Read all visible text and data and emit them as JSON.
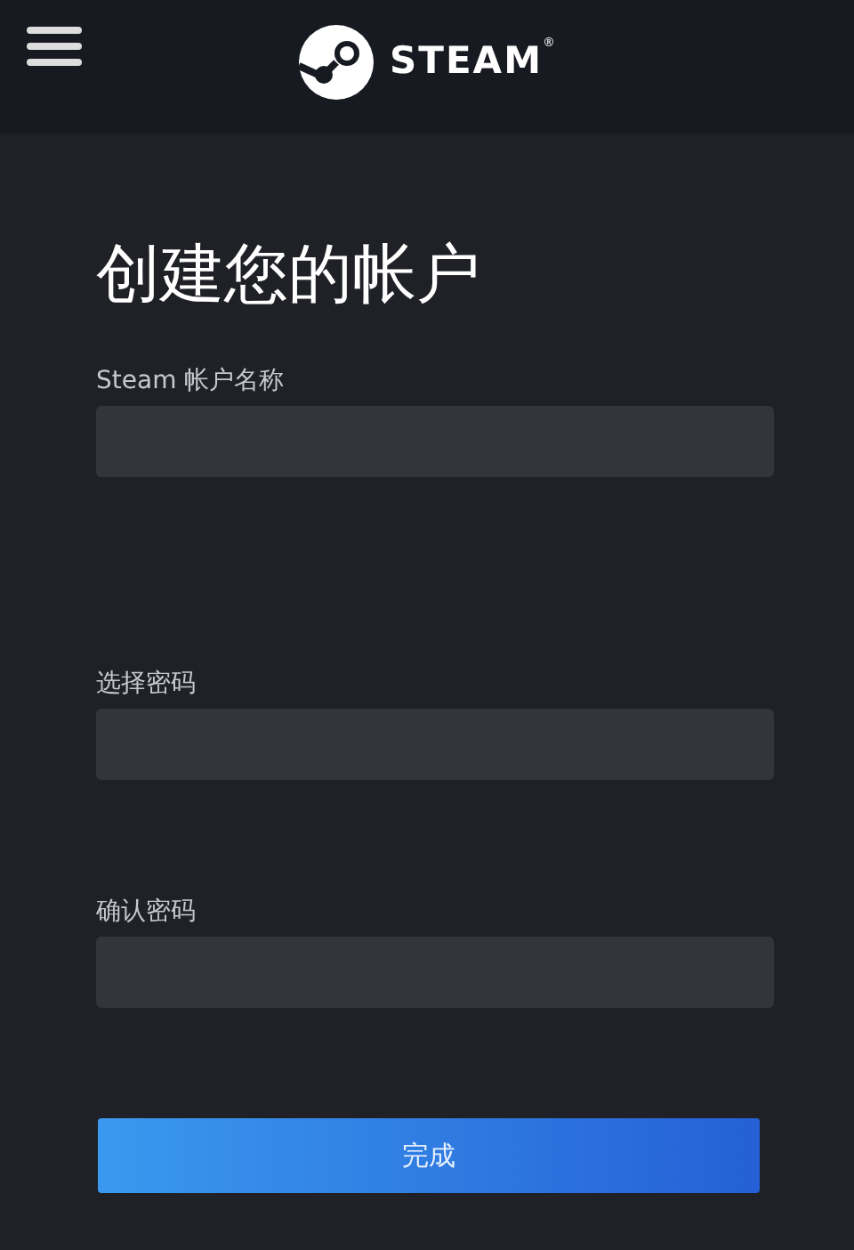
{
  "header": {
    "brand": "STEAM",
    "trademark": "®"
  },
  "title": "创建您的帐户",
  "fields": [
    {
      "label": "Steam 帐户名称"
    },
    {
      "label": "选择密码"
    },
    {
      "label": "确认密码"
    }
  ],
  "submit_button": "完成"
}
